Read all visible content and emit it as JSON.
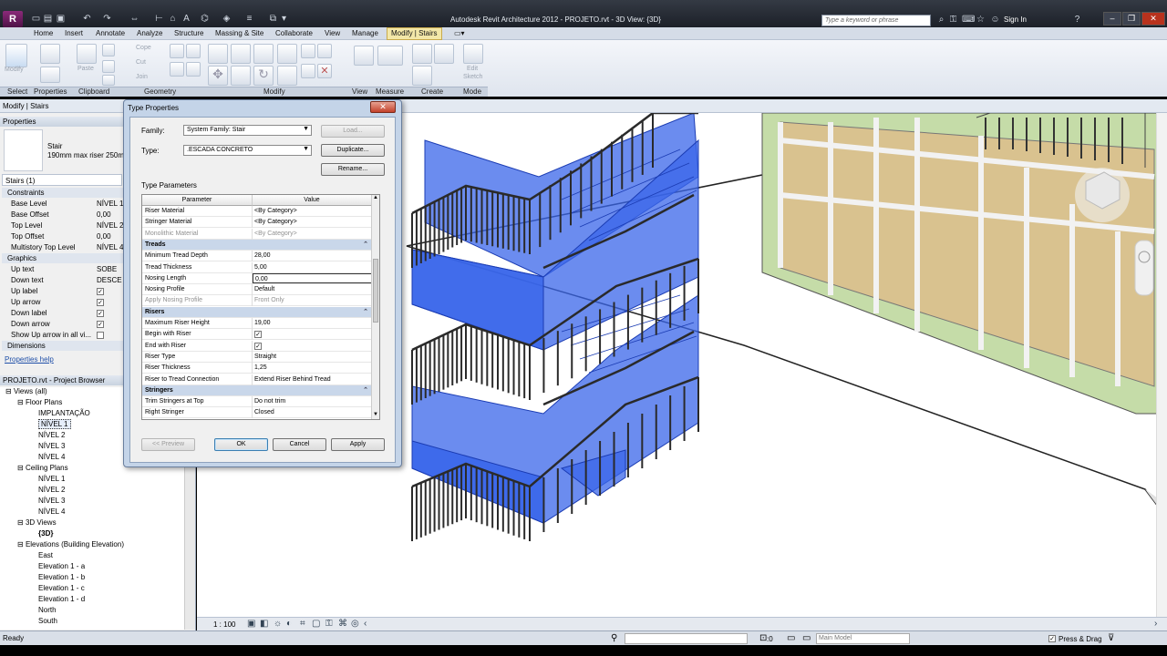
{
  "app": {
    "title": "Autodesk Revit Architecture 2012 -  PROJETO.rvt - 3D View: {3D}",
    "search_placeholder": "Type a keyword or phrase",
    "sign_in": "Sign In"
  },
  "menu": {
    "tabs": [
      "Home",
      "Insert",
      "Annotate",
      "Analyze",
      "Structure",
      "Massing & Site",
      "Collaborate",
      "View",
      "Manage",
      "Modify | Stairs"
    ],
    "active": "Modify | Stairs"
  },
  "ribbon": {
    "panels": [
      "Select",
      "Properties",
      "Clipboard",
      "Geometry",
      "Modify",
      "View",
      "Measure",
      "Create",
      "Mode"
    ],
    "labels": {
      "modify": "Modify",
      "paste": "Paste",
      "cope": "Cope",
      "cut": "Cut",
      "join": "Join",
      "edit_sketch_1": "Edit",
      "edit_sketch_2": "Sketch"
    }
  },
  "context_bar": "Modify | Stairs",
  "properties": {
    "header": "Properties",
    "type_name": "Stair",
    "type_desc": "190mm max riser 250mm",
    "selector": "Stairs (1)",
    "rows": [
      {
        "kind": "cat",
        "label": "Constraints"
      },
      {
        "kind": "row",
        "key": "Base Level",
        "value": "NÍVEL 1"
      },
      {
        "kind": "row",
        "key": "Base Offset",
        "value": "0,00"
      },
      {
        "kind": "row",
        "key": "Top Level",
        "value": "NÍVEL 2"
      },
      {
        "kind": "row",
        "key": "Top Offset",
        "value": "0,00"
      },
      {
        "kind": "row",
        "key": "Multistory Top Level",
        "value": "NÍVEL 4"
      },
      {
        "kind": "cat",
        "label": "Graphics"
      },
      {
        "kind": "row",
        "key": "Up text",
        "value": "SOBE"
      },
      {
        "kind": "row",
        "key": "Down text",
        "value": "DESCE"
      },
      {
        "kind": "row",
        "key": "Up label",
        "value": "✓"
      },
      {
        "kind": "row",
        "key": "Up arrow",
        "value": "✓"
      },
      {
        "kind": "row",
        "key": "Down label",
        "value": "✓"
      },
      {
        "kind": "row",
        "key": "Down arrow",
        "value": "✓"
      },
      {
        "kind": "row",
        "key": "Show Up arrow in all vi...",
        "value": ""
      },
      {
        "kind": "cat",
        "label": "Dimensions"
      }
    ],
    "help": "Properties help"
  },
  "browser": {
    "header": "PROJETO.rvt - Project Browser",
    "items": [
      {
        "label": "Views (all)",
        "level": 0,
        "sign": "−"
      },
      {
        "label": "Floor Plans",
        "level": 1,
        "sign": "−"
      },
      {
        "label": "IMPLANTAÇÃO",
        "level": 2
      },
      {
        "label": "NÍVEL 1",
        "level": 2,
        "selected": true
      },
      {
        "label": "NÍVEL 2",
        "level": 2
      },
      {
        "label": "NÍVEL 3",
        "level": 2
      },
      {
        "label": "NÍVEL 4",
        "level": 2
      },
      {
        "label": "Ceiling Plans",
        "level": 1,
        "sign": "−"
      },
      {
        "label": "NÍVEL 1",
        "level": 2
      },
      {
        "label": "NÍVEL 2",
        "level": 2
      },
      {
        "label": "NÍVEL 3",
        "level": 2
      },
      {
        "label": "NÍVEL 4",
        "level": 2
      },
      {
        "label": "3D Views",
        "level": 1,
        "sign": "−"
      },
      {
        "label": "{3D}",
        "level": 2,
        "bold": true
      },
      {
        "label": "Elevations (Building Elevation)",
        "level": 1,
        "sign": "−"
      },
      {
        "label": "East",
        "level": 2
      },
      {
        "label": "Elevation 1 - a",
        "level": 2
      },
      {
        "label": "Elevation 1 - b",
        "level": 2
      },
      {
        "label": "Elevation 1 - c",
        "level": 2
      },
      {
        "label": "Elevation 1 - d",
        "level": 2
      },
      {
        "label": "North",
        "level": 2
      },
      {
        "label": "South",
        "level": 2
      }
    ]
  },
  "dialog": {
    "title": "Type Properties",
    "family_label": "Family:",
    "family_value": "System Family: Stair",
    "type_label": "Type:",
    "type_value": ".ESCADA CONCRETO",
    "load": "Load...",
    "duplicate": "Duplicate...",
    "rename": "Rename...",
    "params_label": "Type Parameters",
    "col_param": "Parameter",
    "col_value": "Value",
    "rows": [
      {
        "kind": "row",
        "p": "Riser Material",
        "v": "<By Category>"
      },
      {
        "kind": "row",
        "p": "Stringer Material",
        "v": "<By Category>"
      },
      {
        "kind": "gray",
        "p": "Monolithic Material",
        "v": "<By Category>"
      },
      {
        "kind": "grp",
        "p": "Treads",
        "ctl": "⌃"
      },
      {
        "kind": "row",
        "p": "Minimum Tread Depth",
        "v": "28,00"
      },
      {
        "kind": "row",
        "p": "Tread Thickness",
        "v": "5,00"
      },
      {
        "kind": "edit",
        "p": "Nosing Length",
        "v": "0,00"
      },
      {
        "kind": "row",
        "p": "Nosing Profile",
        "v": "Default"
      },
      {
        "kind": "gray",
        "p": "Apply Nosing Profile",
        "v": "Front Only"
      },
      {
        "kind": "grp",
        "p": "Risers",
        "ctl": "⌃"
      },
      {
        "kind": "row",
        "p": "Maximum Riser Height",
        "v": "19,00"
      },
      {
        "kind": "check",
        "p": "Begin with Riser",
        "v": "✓"
      },
      {
        "kind": "check",
        "p": "End with Riser",
        "v": "✓"
      },
      {
        "kind": "row",
        "p": "Riser Type",
        "v": "Straight"
      },
      {
        "kind": "row",
        "p": "Riser Thickness",
        "v": "1,25"
      },
      {
        "kind": "row",
        "p": "Riser to Tread Connection",
        "v": "Extend Riser Behind Tread"
      },
      {
        "kind": "grp",
        "p": "Stringers",
        "ctl": "⌃"
      },
      {
        "kind": "row",
        "p": "Trim Stringers at Top",
        "v": "Do not trim"
      },
      {
        "kind": "row",
        "p": "Right Stringer",
        "v": "Closed"
      }
    ],
    "preview": "<< Preview",
    "ok": "OK",
    "cancel": "Cancel",
    "apply": "Apply"
  },
  "view_bar": {
    "scale": "1 : 100"
  },
  "status": {
    "text": "Ready",
    "filter_count": ":0",
    "model": "Main Model",
    "press_drag": "Press & Drag"
  },
  "colors": {
    "stair_blue": "#3a66ea",
    "railing": "#2a2a2a",
    "wall_green": "#c5dca8",
    "floor_tan": "#d9c28f"
  }
}
